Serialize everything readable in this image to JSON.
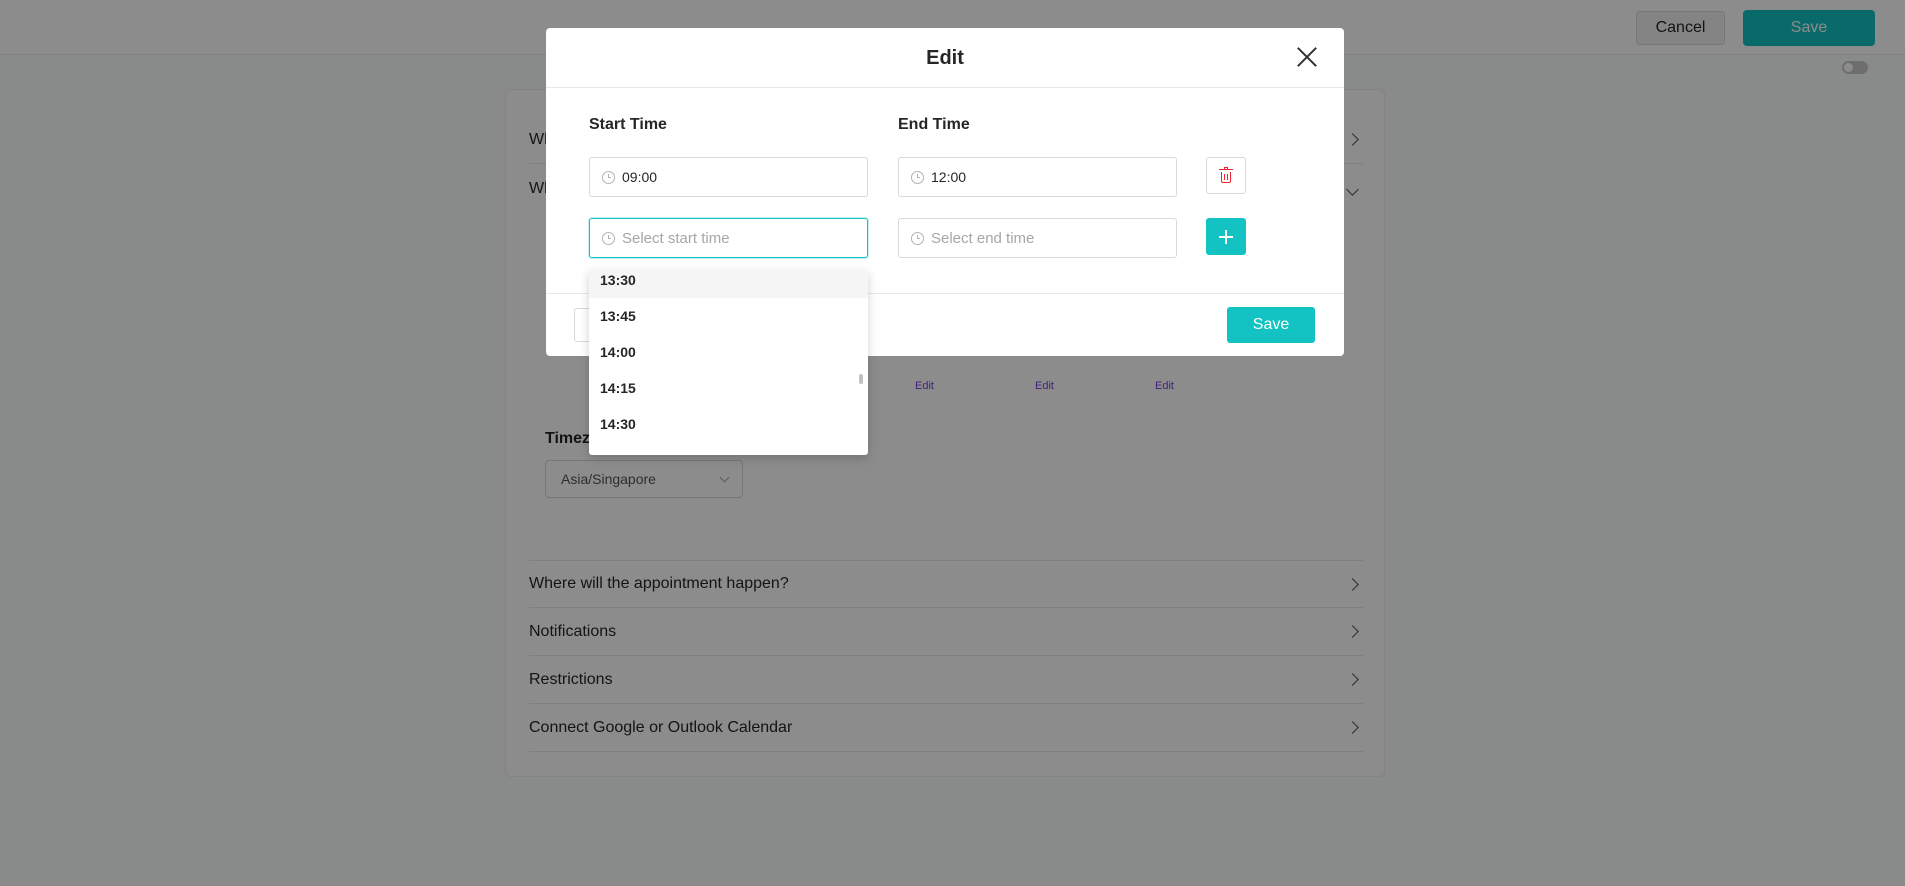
{
  "topbar": {
    "cancel_label": "Cancel",
    "save_label": "Save"
  },
  "background": {
    "rows": [
      {
        "label": "Wh",
        "icon": "chevron-right-icon"
      },
      {
        "label": "Wh",
        "icon": "chevron-down-icon"
      }
    ],
    "edit_links": [
      "Edit",
      "Edit",
      "Edit"
    ],
    "timezone_label": "Timezo",
    "timezone_value": "Asia/Singapore",
    "sections": [
      {
        "label": "Where will the appointment happen?"
      },
      {
        "label": "Notifications"
      },
      {
        "label": "Restrictions"
      },
      {
        "label": "Connect Google or Outlook Calendar"
      }
    ]
  },
  "modal": {
    "title": "Edit",
    "start_label": "Start Time",
    "end_label": "End Time",
    "rows": [
      {
        "start": "09:00",
        "end": "12:00"
      }
    ],
    "new_row": {
      "start_placeholder": "Select start time",
      "end_placeholder": "Select end time"
    },
    "save_label": "Save"
  },
  "dropdown": {
    "options": [
      "13:30",
      "13:45",
      "14:00",
      "14:15",
      "14:30"
    ],
    "active_index": 0
  },
  "colors": {
    "accent": "#13c2c2",
    "danger": "#f5222d",
    "link": "#7b3fe4"
  }
}
